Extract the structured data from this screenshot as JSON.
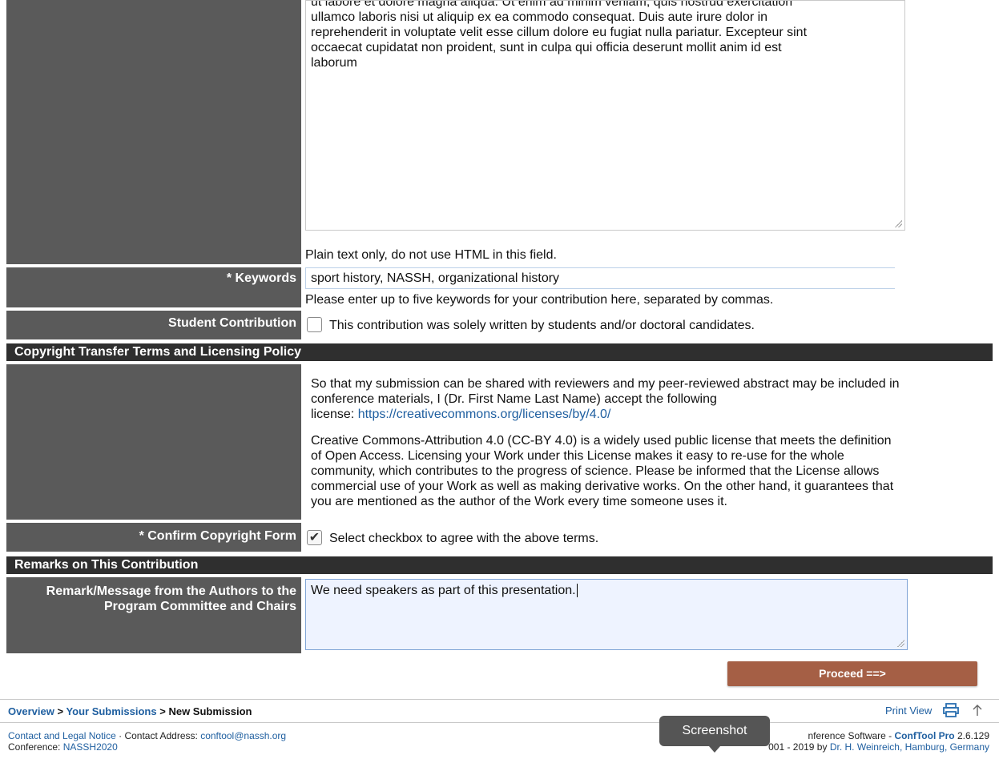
{
  "abstract": {
    "lines": [
      "ut labore et dolore magna aliqua. Ut enim ad minim veniam, quis nostrud exercitation",
      "ullamco laboris nisi ut aliquip ex ea commodo consequat. Duis aute irure dolor in",
      "reprehenderit in voluptate velit esse cillum dolore eu fugiat nulla pariatur. Excepteur sint",
      "occaecat cupidatat non proident, sunt in culpa qui officia deserunt mollit anim id est",
      "laborum"
    ],
    "note": "Plain text only, do not use HTML in this field."
  },
  "keywords": {
    "label": "* Keywords",
    "value": "sport history, NASSH, organizational history",
    "hint": "Please enter up to five keywords for your contribution here, separated by commas."
  },
  "student": {
    "label": "Student Contribution",
    "checked": false,
    "text": "This contribution was solely written by students and/or doctoral candidates."
  },
  "copyright": {
    "section_title": "Copyright Transfer Terms and Licensing Policy",
    "para1_lines": [
      "So that my submission can be shared with reviewers and my peer-reviewed abstract may be included in",
      "conference materials, I (Dr. First Name Last Name) accept the following"
    ],
    "license_prefix": "license: ",
    "license_link": "https://creativecommons.org/licenses/by/4.0/",
    "para2_lines": [
      "Creative Commons-Attribution 4.0 (CC-BY 4.0) is a widely used public license that meets the definition",
      "of Open Access. Licensing your Work under this License makes it easy to re-use for the whole",
      "community, which contributes to the progress of science. Please be informed that the License allows",
      "commercial use of your Work as well as making derivative works. On the other hand, it guarantees that",
      "you are mentioned as the author of the Work every time someone uses it."
    ],
    "confirm_label": "* Confirm Copyright Form",
    "confirm_checked": true,
    "confirm_mark": "✔",
    "confirm_text": "Select checkbox to agree with the above terms."
  },
  "remarks": {
    "section_title": "Remarks on This Contribution",
    "label_line1": "Remark/Message from the Authors to the",
    "label_line2": "Program Committee and Chairs",
    "value": "We need speakers as part of this presentation."
  },
  "proceed_label": "Proceed ==>",
  "breadcrumb": {
    "overview": "Overview",
    "sep": ">",
    "submissions": "Your Submissions",
    "current": "New Submission"
  },
  "print_view": "Print View",
  "footer": {
    "contact_link": "Contact and Legal Notice",
    "dot": "·",
    "address_prefix": "Contact Address:",
    "email": "conftool@nassh.org",
    "conference_prefix": "Conference:",
    "conference": "NASSH2020",
    "software_prefix": "nference Software -",
    "product": "ConfTool Pro",
    "version": "2.6.129",
    "copyright_prefix": "001 - 2019 by",
    "author": "Dr. H. Weinreich, Hamburg, Germany"
  },
  "tooltip": "Screenshot",
  "colors": {
    "label_bg": "#5a5a5a",
    "section_bg": "#2f2f2f",
    "link": "#1f5fa0",
    "proceed_bg": "#a55f45",
    "remark_bg": "#eef3ff"
  }
}
